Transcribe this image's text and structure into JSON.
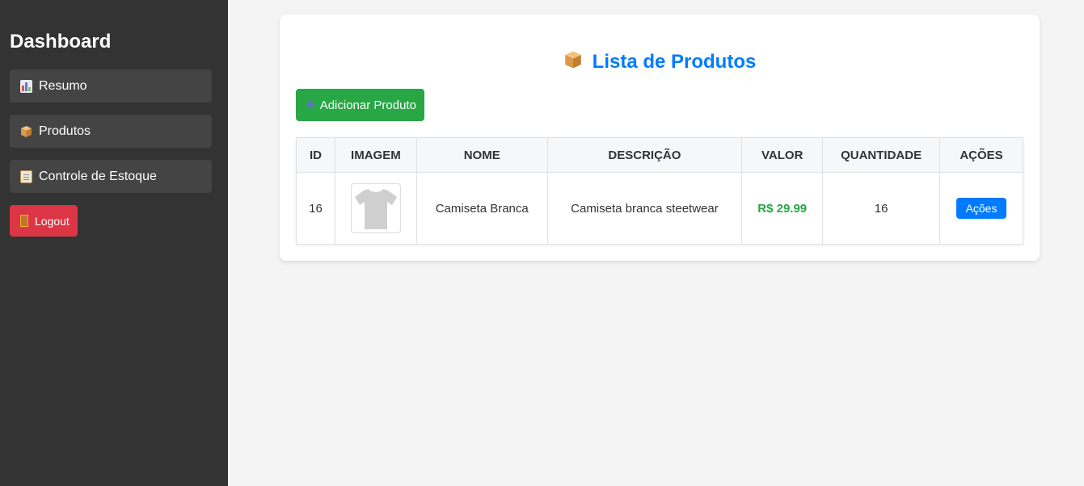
{
  "sidebar": {
    "title": "Dashboard",
    "items": [
      {
        "label": "Resumo",
        "icon": "bar-chart-icon"
      },
      {
        "label": "Produtos",
        "icon": "package-icon"
      },
      {
        "label": "Controle de Estoque",
        "icon": "clipboard-icon"
      }
    ],
    "logout": {
      "label": "Logout",
      "icon": "door-icon"
    }
  },
  "main": {
    "title": "Lista de Produtos",
    "title_icon": "package-icon",
    "add_button": {
      "label": "Adicionar Produto",
      "icon": "plus-icon"
    },
    "table": {
      "headers": [
        "ID",
        "IMAGEM",
        "NOME",
        "DESCRIÇÃO",
        "VALOR",
        "QUANTIDADE",
        "AÇÕES"
      ],
      "rows": [
        {
          "id": "16",
          "image": "t-shirt-image",
          "nome": "Camiseta Branca",
          "descricao": "Camiseta branca steetwear",
          "valor": "R$ 29.99",
          "quantidade": "16",
          "acoes": "Ações"
        }
      ]
    }
  },
  "colors": {
    "sidebar_bg": "#333333",
    "nav_item_bg": "#444444",
    "accent_blue": "#007bff",
    "success_green": "#28a745",
    "danger_red": "#dc3545"
  }
}
